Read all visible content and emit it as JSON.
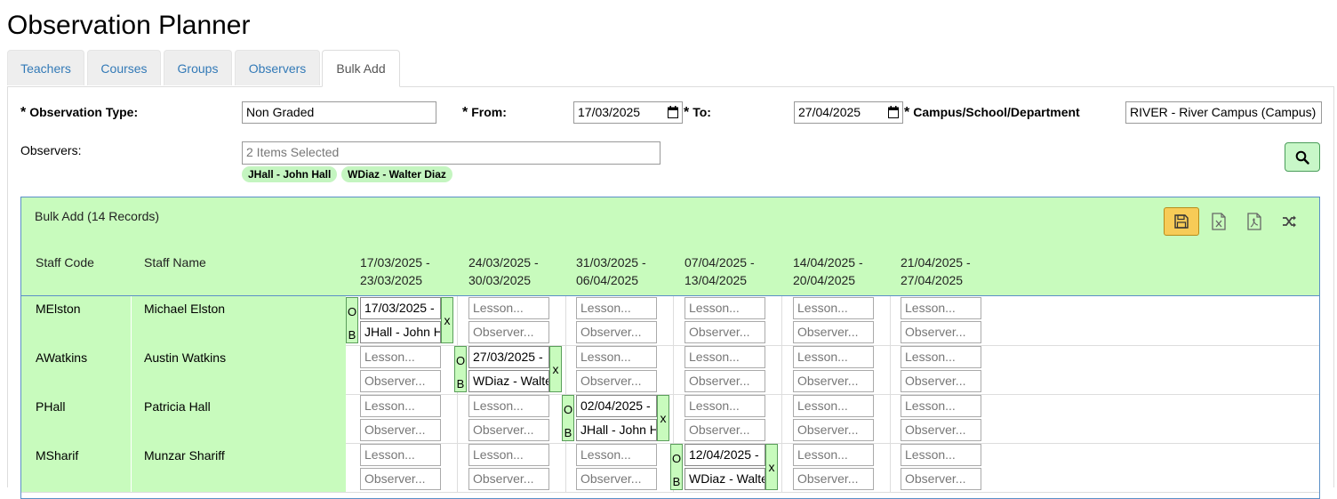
{
  "page": {
    "title": "Observation Planner"
  },
  "tabs": [
    {
      "label": "Teachers"
    },
    {
      "label": "Courses"
    },
    {
      "label": "Groups"
    },
    {
      "label": "Observers"
    },
    {
      "label": "Bulk Add",
      "active": true
    }
  ],
  "filters": {
    "observation_type_label": "Observation Type:",
    "observation_type_value": "Non Graded",
    "from_label": "From:",
    "from_value": "17/03/2025",
    "to_label": "To:",
    "to_value": "27/04/2025",
    "campus_label": "Campus/School/Department",
    "campus_value": "RIVER - River Campus (Campus)",
    "observers_label": "Observers:",
    "observers_placeholder": "2 Items Selected",
    "observer_chips": [
      "JHall - John Hall",
      "WDiaz - Walter Diaz"
    ],
    "required_mark": "*"
  },
  "grid": {
    "title": "Bulk Add (14 Records)",
    "toolbar_icons": [
      "save-icon",
      "excel-export-icon",
      "pdf-export-icon",
      "shuffle-icon"
    ],
    "headers": {
      "staff_code": "Staff Code",
      "staff_name": "Staff Name",
      "weeks": [
        {
          "l1": "17/03/2025 -",
          "l2": "23/03/2025"
        },
        {
          "l1": "24/03/2025 -",
          "l2": "30/03/2025"
        },
        {
          "l1": "31/03/2025 -",
          "l2": "06/04/2025"
        },
        {
          "l1": "07/04/2025 -",
          "l2": "13/04/2025"
        },
        {
          "l1": "14/04/2025 -",
          "l2": "20/04/2025"
        },
        {
          "l1": "21/04/2025 -",
          "l2": "27/04/2025"
        }
      ]
    },
    "lesson_placeholder": "Lesson...",
    "observer_placeholder": "Observer...",
    "ob_letters": [
      "O",
      "B"
    ],
    "remove_label": "x",
    "rows": [
      {
        "code": "MElston",
        "name": "Michael Elston",
        "assigned_week": 0,
        "lesson": "17/03/2025 - ",
        "observer": "JHall - John Hall"
      },
      {
        "code": "AWatkins",
        "name": "Austin Watkins",
        "assigned_week": 1,
        "lesson": "27/03/2025 - ",
        "observer": "WDiaz - Walter Diaz"
      },
      {
        "code": "PHall",
        "name": "Patricia Hall",
        "assigned_week": 2,
        "lesson": "02/04/2025 - ",
        "observer": "JHall - John Hall"
      },
      {
        "code": "MSharif",
        "name": "Munzar Shariff",
        "assigned_week": 3,
        "lesson": "12/04/2025 - ",
        "observer": "WDiaz - Walter Diaz"
      }
    ]
  },
  "colors": {
    "grid_green": "#c8fbbd",
    "chip_green": "#c4f5c0",
    "save_active": "#f7cb57",
    "link_blue": "#337ab7"
  }
}
